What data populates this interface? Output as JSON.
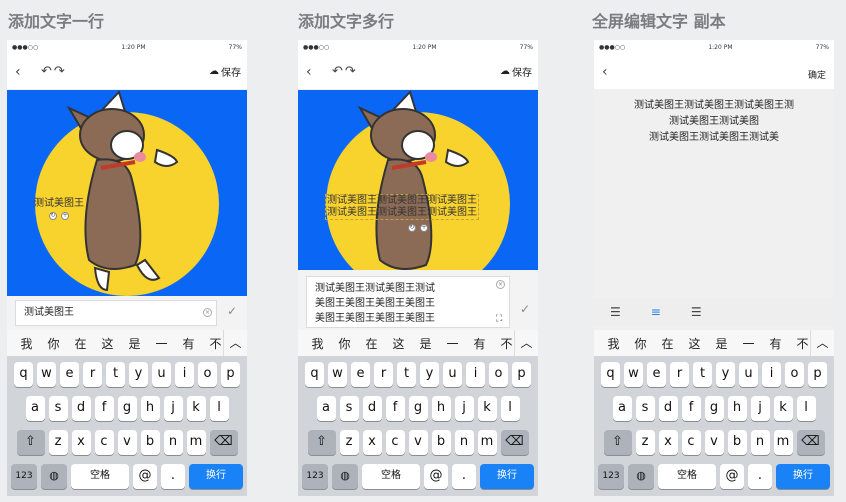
{
  "titles": [
    "添加文字一行",
    "添加文字多行",
    "全屏编辑文字 副本"
  ],
  "status": {
    "carrier": "●●●○○",
    "time": "1:20 PM",
    "battery": "77%"
  },
  "nav": {
    "save": "保存",
    "confirm": "确定"
  },
  "panel1": {
    "overlay": "测试美图王",
    "input": "测试美图王"
  },
  "panel2": {
    "overlay": [
      "测试美图王测试美图王测试美图王",
      "测试美图王测试美图王测试美图王"
    ],
    "input": [
      "测试美图王测试美图王测试",
      "美图王美图王美图王美图王",
      "美图王美图王美图王美图王"
    ]
  },
  "panel3": {
    "text": [
      "测试美图王测试美图王测试美图王测",
      "测试美图王测试美图",
      "测试美图王测试美图王测试美"
    ]
  },
  "candidates": [
    "我",
    "你",
    "在",
    "这",
    "是",
    "一",
    "有",
    "不"
  ],
  "keyboard": {
    "row1": [
      "q",
      "w",
      "e",
      "r",
      "t",
      "y",
      "u",
      "i",
      "o",
      "p"
    ],
    "row2": [
      "a",
      "s",
      "d",
      "f",
      "g",
      "h",
      "j",
      "k",
      "l"
    ],
    "row3": [
      "z",
      "x",
      "c",
      "v",
      "b",
      "n",
      "m"
    ],
    "num": "123",
    "space": "空格",
    "at": "@",
    "dot": ".",
    "go": "换行"
  }
}
